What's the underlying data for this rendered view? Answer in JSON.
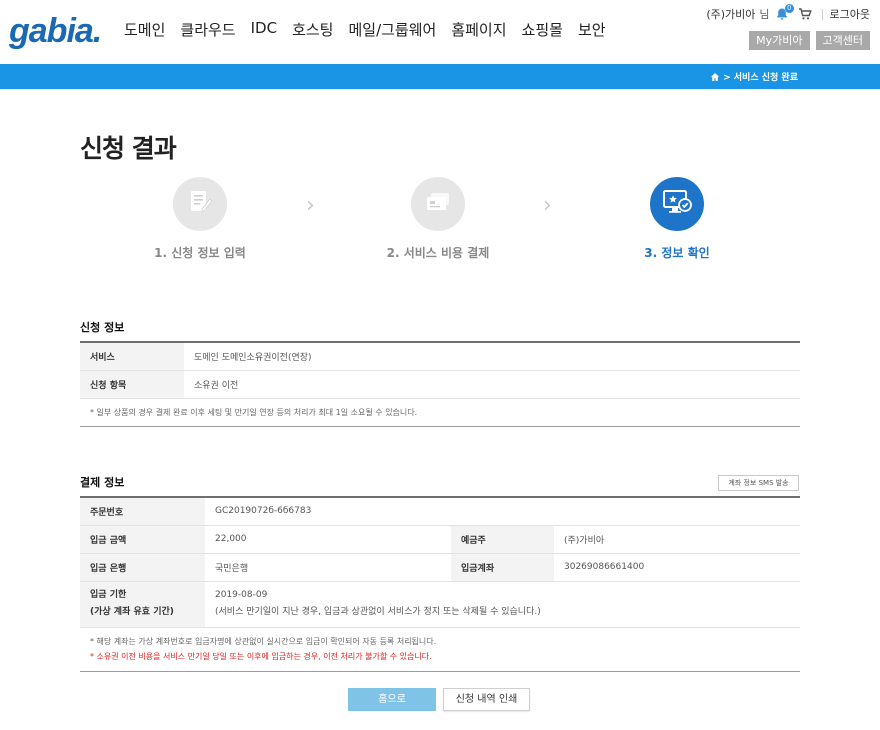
{
  "header": {
    "logo": "gabia.",
    "nav": [
      "도메인",
      "클라우드",
      "IDC",
      "호스팅",
      "메일/그룹웨어",
      "홈페이지",
      "쇼핑몰",
      "보안"
    ],
    "user_name": "(주)가비아",
    "user_suffix": "님",
    "notification_count": "0",
    "logout": "로그아웃",
    "my_gabia": "My가비아",
    "customer_center": "고객센터"
  },
  "breadcrumb": {
    "text": "> 서비스 신청 완료"
  },
  "page_title": "신청 결과",
  "steps": [
    {
      "label": "1. 신청 정보 입력",
      "active": false
    },
    {
      "label": "2. 서비스 비용 결제",
      "active": false
    },
    {
      "label": "3. 정보 확인",
      "active": true
    }
  ],
  "apply_info": {
    "title": "신청 정보",
    "rows": [
      {
        "label": "서비스",
        "value": "도메인 도메인소유권이전(연장)"
      },
      {
        "label": "신청 항목",
        "value": "소유권 이전"
      }
    ],
    "note": "* 일부 상품의 경우 결제 완료 이후 세팅 및 만기일 연장 등의 처리가 최대 1일 소요될 수 있습니다."
  },
  "payment_info": {
    "title": "결제 정보",
    "sms_button": "계좌 정보 SMS 발송",
    "order_no_label": "주문번호",
    "order_no": "GC2019072б-6б6783",
    "amount_label": "입금 금액",
    "amount": "22,000",
    "depositor_label": "예금주",
    "depositor": "(주)가비아",
    "bank_label": "입금 은행",
    "bank": "국민은행",
    "account_label": "입금계좌",
    "account": "30269086661400",
    "period_label_1": "입금 기한",
    "period_label_2": "(가상 계좌 유효 기간)",
    "period_date": "2019-08-09",
    "period_note": "(서비스 만기일이 지난 경우, 입금과 상관없이 서비스가 정지 또는 삭제될 수 있습니다.)",
    "note_1": "* 해당 계좌는 가상 계좌번호로 입금자명에 상관없이 실시간으로 입금이 확인되어 자동 등록 처리됩니다.",
    "note_2": "* 소유권 이전 비용을 서비스 만기일 당일 또는 이후에 입금하는 경우, 이전 처리가 불가할 수 있습니다."
  },
  "buttons": {
    "home": "홈으로",
    "print": "신청 내역 인쇄"
  },
  "colors": {
    "brand": "#1b68b3",
    "bar": "#1a94e4",
    "active_step": "#1e74c8",
    "warning": "#e02020"
  }
}
